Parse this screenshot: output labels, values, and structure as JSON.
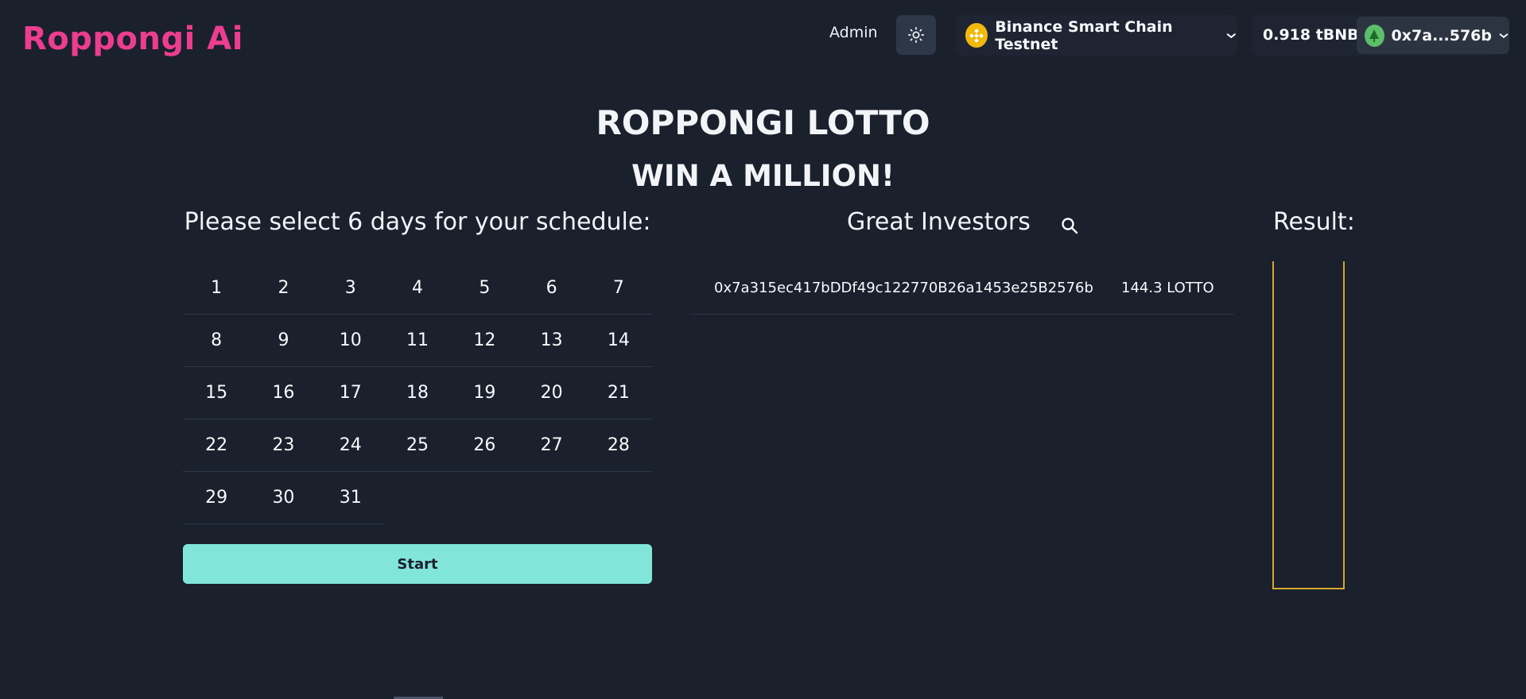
{
  "header": {
    "logo": "Roppongi Ai",
    "admin_label": "Admin",
    "chain_name": "Binance Smart Chain Testnet",
    "balance": "0.918 tBNB",
    "account": "0x7a...576b"
  },
  "main": {
    "title": "ROPPONGI LOTTO",
    "subtitle": "WIN A MILLION!"
  },
  "schedule": {
    "heading": "Please select 6 days for your schedule:",
    "days": [
      "1",
      "2",
      "3",
      "4",
      "5",
      "6",
      "7",
      "8",
      "9",
      "10",
      "11",
      "12",
      "13",
      "14",
      "15",
      "16",
      "17",
      "18",
      "19",
      "20",
      "21",
      "22",
      "23",
      "24",
      "25",
      "26",
      "27",
      "28",
      "29",
      "30",
      "31"
    ],
    "start_label": "Start"
  },
  "investors": {
    "heading": "Great Investors",
    "rows": [
      {
        "address": "0x7a315ec417bDDf49c122770B26a1453e25B2576b",
        "amount": "144.3 LOTTO"
      }
    ]
  },
  "result": {
    "heading": "Result:"
  },
  "colors": {
    "background": "#1a202c",
    "logo": "#ec3d8e",
    "start_button": "#81e6d9",
    "result_border": "#d4a72c",
    "bnb": "#f0b90b"
  },
  "icons": [
    "sun-icon",
    "bnb-icon",
    "chevron-down-icon",
    "avatar-icon",
    "search-icon"
  ]
}
